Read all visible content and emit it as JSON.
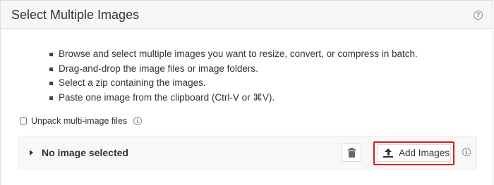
{
  "panel": {
    "title": "Select Multiple Images",
    "help_icon": "?"
  },
  "instructions": [
    "Browse and select multiple images you want to resize, convert, or compress in batch.",
    "Drag-and-drop the image files or image folders.",
    "Select a zip containing the images.",
    "Paste one image from the clipboard (Ctrl-V or ⌘V)."
  ],
  "unpack": {
    "label": "Unpack multi-image files",
    "checked": false,
    "info_icon": "i"
  },
  "file_list": {
    "status": "No image selected",
    "add_label": "Add Images",
    "info_icon": "i"
  },
  "colors": {
    "highlight": "#d61f1f",
    "header_bg": "#f7f7f7",
    "file_box_bg": "#f8f8f8"
  }
}
